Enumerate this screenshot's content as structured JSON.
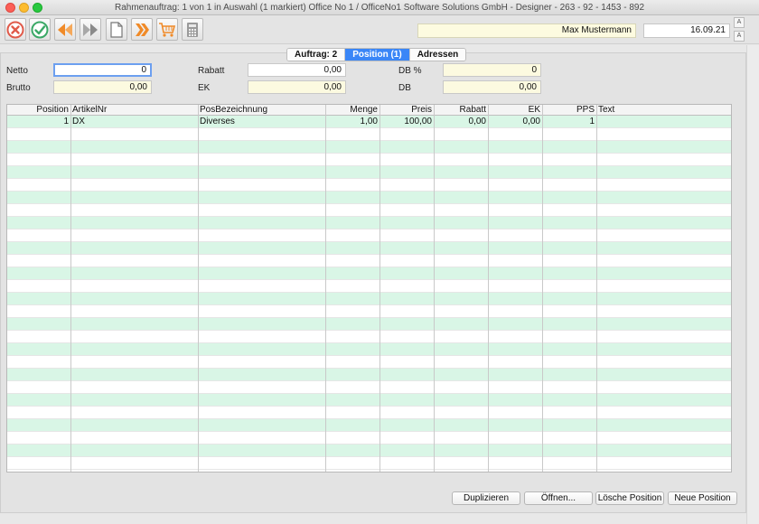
{
  "window": {
    "title": "Rahmenauftrag: 1 von 1 in Auswahl  (1 markiert) Office No 1 /  OfficeNo1 Software Solutions GmbH - Designer - 263 - 92 - 1453 - 892"
  },
  "toolbar": {
    "buttons": [
      "cancel",
      "confirm",
      "previous",
      "next",
      "new-document",
      "forward",
      "cart",
      "calculator"
    ],
    "user": "Max Mustermann",
    "date": "16.09.21",
    "font_larger": "A",
    "font_smaller": "A"
  },
  "tabs": [
    {
      "label": "Auftrag: 2",
      "active": false
    },
    {
      "label": "Position (1)",
      "active": true
    },
    {
      "label": "Adressen",
      "active": false
    }
  ],
  "summary": {
    "netto_label": "Netto",
    "netto_value": "0",
    "brutto_label": "Brutto",
    "brutto_value": "0,00",
    "rabatt_label": "Rabatt",
    "rabatt_value": "0,00",
    "ek_label": "EK",
    "ek_value": "0,00",
    "dbp_label": "DB %",
    "dbp_value": "0",
    "db_label": "DB",
    "db_value": "0,00"
  },
  "table": {
    "columns": [
      "Position",
      "ArtikelNr",
      "PosBezeichnung",
      "Menge",
      "Preis",
      "Rabatt",
      "EK",
      "PPS",
      "Text"
    ],
    "rows": [
      [
        "1",
        "DX",
        "Diverses",
        "1,00",
        "100,00",
        "0,00",
        "0,00",
        "1",
        ""
      ]
    ],
    "empty_rows": 27
  },
  "buttons": {
    "duplicate": "Duplizieren",
    "open": "Öffnen...",
    "delete_position": "Lösche Position",
    "new_position": "Neue Position"
  },
  "colors": {
    "accent_tab": "#3a86f7",
    "row_stripe": "#d9f6e6",
    "readonly_field": "#fcfae0"
  }
}
